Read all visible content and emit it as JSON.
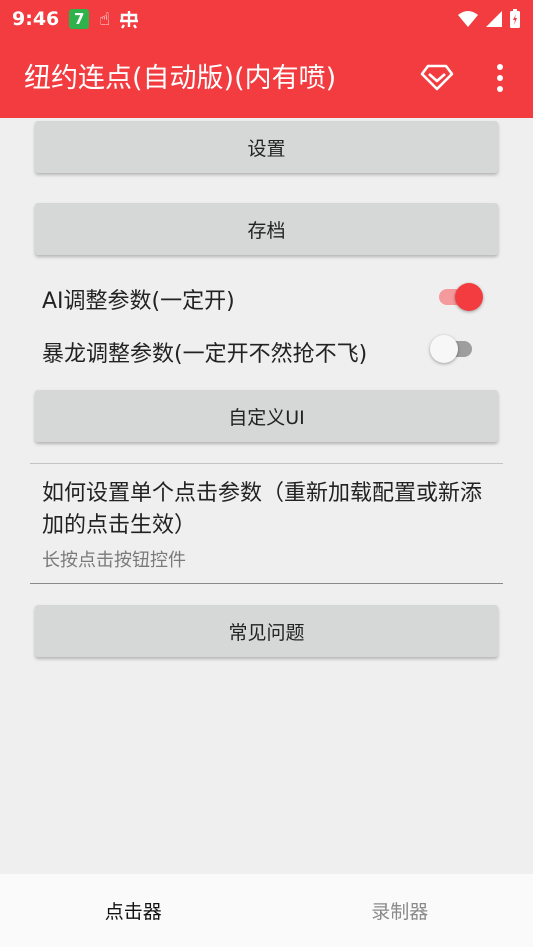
{
  "status": {
    "time": "9:46",
    "badge": "7"
  },
  "appbar": {
    "title": "纽约连点(自动版)(内有喷)"
  },
  "buttons": {
    "settings": "设置",
    "archive": "存档",
    "custom_ui": "自定义UI",
    "faq": "常见问题"
  },
  "switches": {
    "ai": {
      "label": "AI调整参数(一定开)",
      "on": true
    },
    "baolong": {
      "label": "暴龙调整参数(一定开不然抢不飞)",
      "on": false
    }
  },
  "pref": {
    "title": "如何设置单个点击参数（重新加载配置或新添加的点击生效）",
    "summary": "长按点击按钮控件"
  },
  "tabs": [
    {
      "label": "点击器",
      "active": true
    },
    {
      "label": "录制器",
      "active": false
    }
  ],
  "colors": {
    "accent": "#f23c40"
  }
}
